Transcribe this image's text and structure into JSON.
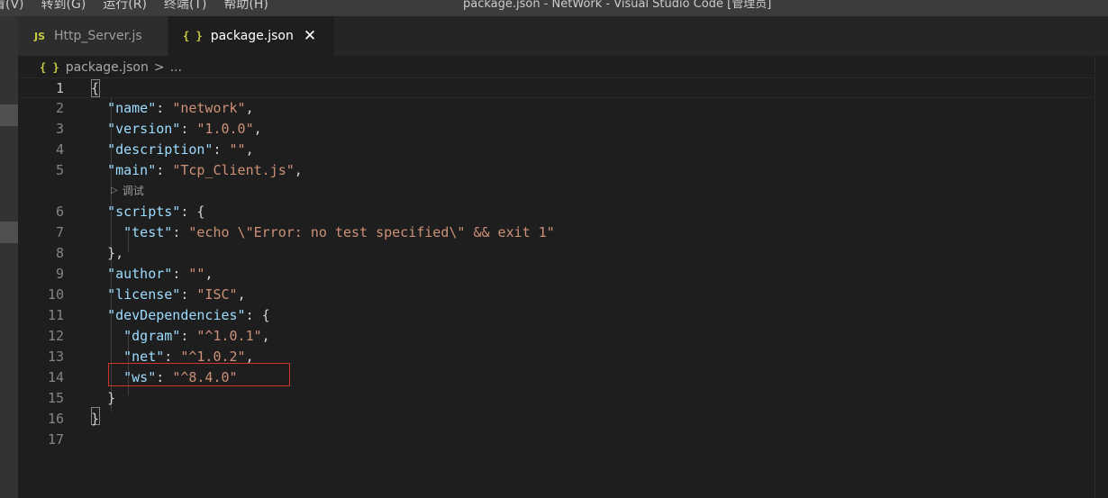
{
  "menu": {
    "items": [
      "看(V)",
      "转到(G)",
      "运行(R)",
      "终端(T)",
      "帮助(H)"
    ]
  },
  "window": {
    "title": "package.json - NetWork - Visual Studio Code [管理员]"
  },
  "tabs": [
    {
      "icon": "JS",
      "label": "Http_Server.js",
      "active": false
    },
    {
      "icon": "{ }",
      "label": "package.json",
      "active": true
    }
  ],
  "breadcrumb": {
    "icon": "{ }",
    "file": "package.json",
    "separator": ">",
    "more": "..."
  },
  "codelens": {
    "icon": "▷",
    "label": "调试"
  },
  "colors": {
    "key": "#9cdcfe",
    "string": "#ce9178",
    "highlight_box": "#d0342c"
  },
  "editor": {
    "lines": [
      {
        "n": "1",
        "indent": "",
        "key": "",
        "sep": "{",
        "value": "",
        "end": ""
      },
      {
        "n": "2",
        "indent": "  ",
        "key": "\"name\"",
        "sep": ": ",
        "value": "\"network\"",
        "end": ","
      },
      {
        "n": "3",
        "indent": "  ",
        "key": "\"version\"",
        "sep": ": ",
        "value": "\"1.0.0\"",
        "end": ","
      },
      {
        "n": "4",
        "indent": "  ",
        "key": "\"description\"",
        "sep": ": ",
        "value": "\"\"",
        "end": ","
      },
      {
        "n": "5",
        "indent": "  ",
        "key": "\"main\"",
        "sep": ": ",
        "value": "\"Tcp_Client.js\"",
        "end": ","
      },
      {
        "n": "6",
        "indent": "  ",
        "key": "\"scripts\"",
        "sep": ": {",
        "value": "",
        "end": ""
      },
      {
        "n": "7",
        "indent": "    ",
        "key": "\"test\"",
        "sep": ": ",
        "value": "\"echo \\\"Error: no test specified\\\" && exit 1\"",
        "end": ""
      },
      {
        "n": "8",
        "indent": "  ",
        "key": "",
        "sep": "},",
        "value": "",
        "end": ""
      },
      {
        "n": "9",
        "indent": "  ",
        "key": "\"author\"",
        "sep": ": ",
        "value": "\"\"",
        "end": ","
      },
      {
        "n": "10",
        "indent": "  ",
        "key": "\"license\"",
        "sep": ": ",
        "value": "\"ISC\"",
        "end": ","
      },
      {
        "n": "11",
        "indent": "  ",
        "key": "\"devDependencies\"",
        "sep": ": {",
        "value": "",
        "end": ""
      },
      {
        "n": "12",
        "indent": "    ",
        "key": "\"dgram\"",
        "sep": ": ",
        "value": "\"^1.0.1\"",
        "end": ","
      },
      {
        "n": "13",
        "indent": "    ",
        "key": "\"net\"",
        "sep": ": ",
        "value": "\"^1.0.2\"",
        "end": ","
      },
      {
        "n": "14",
        "indent": "    ",
        "key": "\"ws\"",
        "sep": ": ",
        "value": "\"^8.4.0\"",
        "end": ""
      },
      {
        "n": "15",
        "indent": "  ",
        "key": "",
        "sep": "}",
        "value": "",
        "end": ""
      },
      {
        "n": "16",
        "indent": "",
        "key": "",
        "sep": "}",
        "value": "",
        "end": ""
      },
      {
        "n": "17",
        "indent": "",
        "key": "",
        "sep": "",
        "value": "",
        "end": ""
      }
    ]
  }
}
